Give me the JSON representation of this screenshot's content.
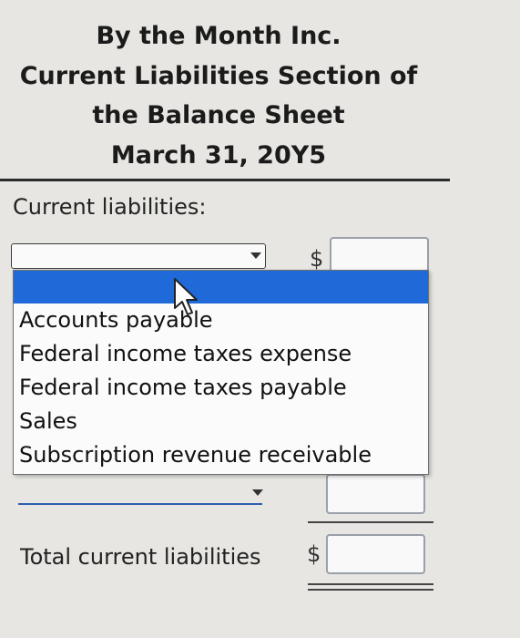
{
  "heading": {
    "company": "By the Month Inc.",
    "title_line1": "Current Liabilities Section of",
    "title_line2": "the Balance Sheet",
    "date": "March 31, 20Y5"
  },
  "section_label": "Current liabilities:",
  "currency_symbol": "$",
  "dropdown": {
    "selected_value": "",
    "options": [
      "Accounts payable",
      "Federal income taxes expense",
      "Federal income taxes payable",
      "Sales",
      "Subscription revenue receivable"
    ]
  },
  "amounts": {
    "row1": "",
    "row2": "",
    "total": ""
  },
  "total_label": "Total current liabilities",
  "colors": {
    "highlight": "#1f6ad8",
    "background": "#e7e6e2"
  },
  "icons": {
    "cursor": "mouse-pointer-icon",
    "caret": "chevron-down-icon"
  }
}
